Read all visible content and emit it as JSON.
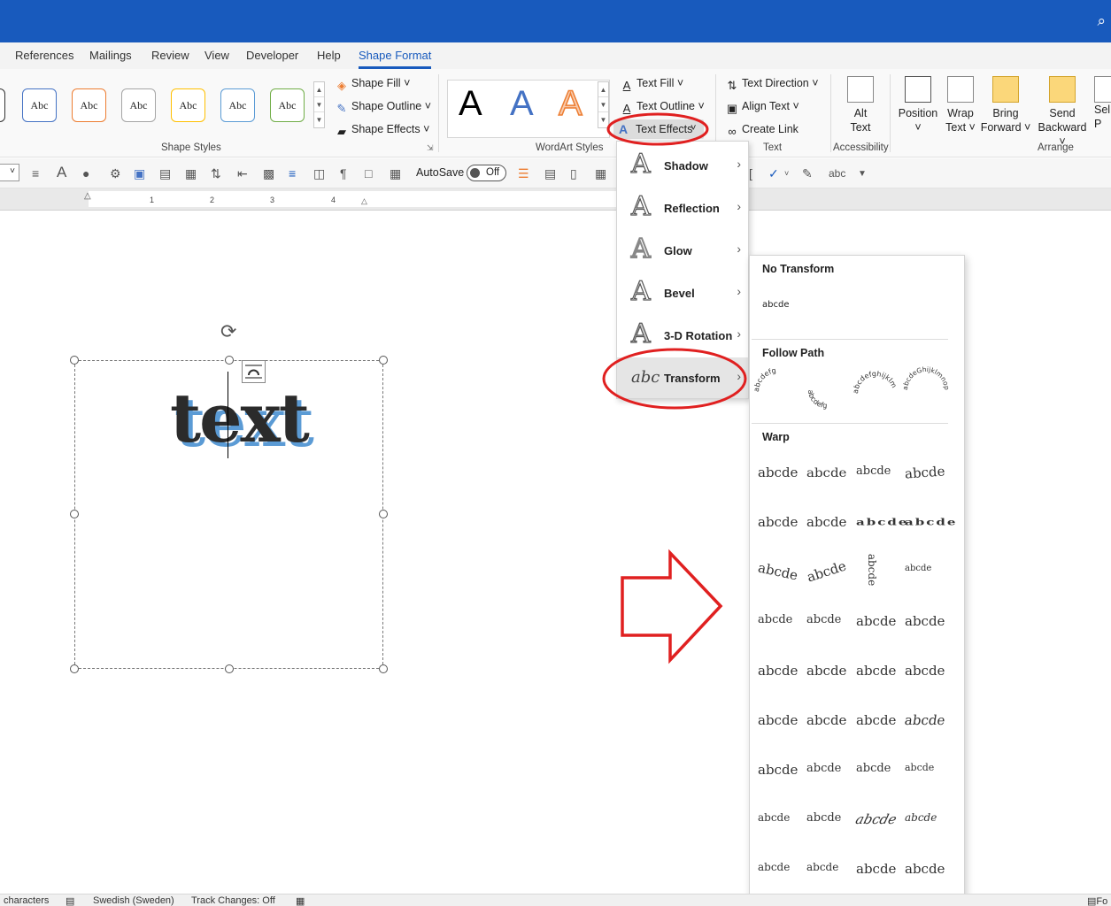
{
  "tabs": [
    "References",
    "Mailings",
    "Review",
    "View",
    "Developer",
    "Help",
    "Shape Format"
  ],
  "active_tab": "Shape Format",
  "ribbon": {
    "shape_styles": {
      "swatch_label": "Abc",
      "group_label": "Shape Styles",
      "shape_fill": "Shape Fill",
      "shape_outline": "Shape Outline",
      "shape_effects": "Shape Effects",
      "swatch_colors": [
        "#333333",
        "#4472c4",
        "#ed7d31",
        "#a5a5a5",
        "#ffc000",
        "#5b9bd5",
        "#70ad47"
      ]
    },
    "wordart": {
      "group_label": "WordArt Styles",
      "letter": "A",
      "text_fill": "Text Fill",
      "text_outline": "Text Outline",
      "text_effects": "Text Effects"
    },
    "text": {
      "group_label": "Text",
      "text_direction": "Text Direction",
      "align_text": "Align Text",
      "create_link": "Create Link"
    },
    "accessibility": {
      "group_label": "Accessibility",
      "alt_text": [
        "Alt",
        "Text"
      ]
    },
    "arrange": {
      "group_label": "Arrange",
      "position": "Position",
      "wrap_text": [
        "Wrap",
        "Text"
      ],
      "bring_forward": [
        "Bring",
        "Forward"
      ],
      "send_backward": [
        "Send",
        "Backward"
      ],
      "selection": [
        "Sel",
        "P"
      ]
    }
  },
  "qat": {
    "autosave_label": "AutoSave",
    "autosave_state": "Off"
  },
  "ruler": {
    "numbers": [
      "1",
      "2",
      "3",
      "4"
    ]
  },
  "document": {
    "shape_text": "text"
  },
  "text_effects_menu": {
    "items": [
      {
        "label": "Shadow"
      },
      {
        "label": "Reflection"
      },
      {
        "label": "Glow"
      },
      {
        "label": "Bevel"
      },
      {
        "label": "3-D Rotation"
      },
      {
        "label": "Transform"
      }
    ],
    "transform_icon_text": "abc"
  },
  "transform_menu": {
    "no_transform_heading": "No Transform",
    "no_transform_sample": "abcde",
    "follow_path_heading": "Follow Path",
    "follow_path_samples": [
      "abcdefg",
      "abcdefg",
      "abcdefghijklm",
      "abcdeGhijklmnop"
    ],
    "warp_heading": "Warp",
    "warp_sample": "abcde",
    "more_indicator": "....."
  },
  "status_bar": {
    "words": "characters",
    "language": "Swedish (Sweden)",
    "track_changes": "Track Changes: Off",
    "focus": "Fo"
  },
  "colors": {
    "accent": "#185abd",
    "highlight_circle": "#e02020",
    "arrow": "#e02020",
    "text_shadow": "#5b9bd5"
  }
}
